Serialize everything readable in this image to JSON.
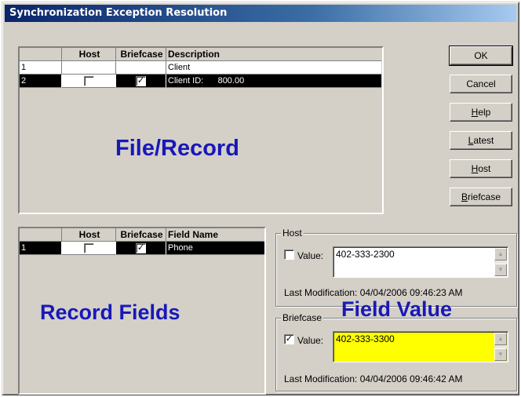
{
  "window": {
    "title": "Synchronization Exception Resolution"
  },
  "file_grid": {
    "columns": [
      "",
      "Host",
      "Briefcase",
      "Description"
    ],
    "rows": [
      {
        "num": "1",
        "host_checked": false,
        "briefcase_checked": false,
        "description": "Client",
        "selected": false
      },
      {
        "num": "2",
        "host_checked": false,
        "briefcase_checked": true,
        "description": "Client ID:      800.00",
        "selected": true
      }
    ]
  },
  "field_grid": {
    "columns": [
      "",
      "Host",
      "Briefcase",
      "Field Name"
    ],
    "rows": [
      {
        "num": "1",
        "host_checked": false,
        "briefcase_checked": true,
        "field_name": "Phone",
        "selected": true
      }
    ]
  },
  "labels": {
    "file_record": "File/Record",
    "record_fields": "Record Fields",
    "field_value": "Field Value"
  },
  "buttons": {
    "ok": "OK",
    "cancel": "Cancel",
    "help": "Help",
    "latest": "Latest",
    "host": "Host",
    "briefcase": "Briefcase"
  },
  "host_group": {
    "legend": "Host",
    "checked": false,
    "value_label": "Value:",
    "value": "402-333-2300",
    "last_mod": "Last Modification:  04/04/2006  09:46:23 AM"
  },
  "briefcase_group": {
    "legend": "Briefcase",
    "checked": true,
    "value_label": "Value:",
    "value": "402-333-3300",
    "last_mod": "Last Modification:  04/04/2006  09:46:42 AM"
  },
  "colors": {
    "label_blue": "#1818b8",
    "briefcase_value_bg": "#ffff00",
    "title_bar": "#0a246a"
  }
}
